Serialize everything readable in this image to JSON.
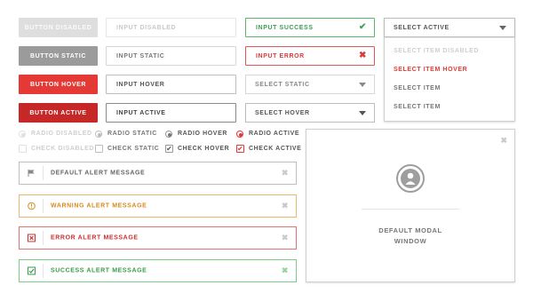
{
  "buttons": {
    "disabled": "BUTTON DISABLED",
    "static": "BUTTON STATIC",
    "hover": "BUTTON HOVER",
    "active": "BUTTON ACTIVE"
  },
  "inputs": {
    "disabled": "INPUT DISABLED",
    "static": "INPUT STATIC",
    "hover": "INPUT HOVER",
    "active": "INPUT ACTIVE",
    "success": "INPUT SUCCESS",
    "error": "INPUT ERROR"
  },
  "selects": {
    "static": "SELECT STATIC",
    "hover": "SELECT HOVER",
    "active": "SELECT ACTIVE"
  },
  "dropdown": {
    "items": [
      "SELECT ITEM DISABLED",
      "SELECT ITEM HOVER",
      "SELECT ITEM",
      "SELECT ITEM"
    ]
  },
  "radios": {
    "disabled": "RADIO DISABLED",
    "static": "RADIO STATIC",
    "hover": "RADIO HOVER",
    "active": "RADIO ACTIVE"
  },
  "checks": {
    "disabled": "CHECK DISABLED",
    "static": "CHECK STATIC",
    "hover": "CHECK HOVER",
    "active": "CHECK ACTIVE"
  },
  "alerts": {
    "default": "DEFAULT ALERT MESSAGE",
    "warning": "WARNING ALERT MESSAGE",
    "error": "ERROR ALERT MESSAGE",
    "success": "SUCCESS ALERT MESSAGE"
  },
  "modal": {
    "title_line1": "DEFAULT MODAL",
    "title_line2": "WINDOW"
  },
  "colors": {
    "accent_red": "#e53935",
    "success_green": "#57b86a",
    "warning_orange": "#e8b86b"
  }
}
